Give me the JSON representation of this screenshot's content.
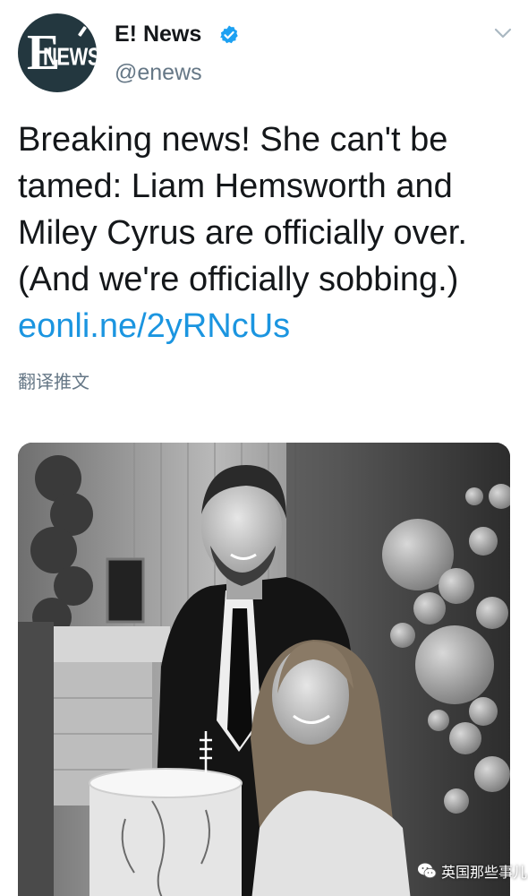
{
  "account": {
    "display_name": "E! News",
    "handle": "@enews",
    "verified": true,
    "avatar_letter": "E",
    "avatar_word": "NEWS"
  },
  "tweet": {
    "lines": [
      "Breaking news! She can't be",
      "tamed: Liam Hemsworth and",
      "Miley Cyrus are officially over.",
      "(And we're officially sobbing.)"
    ],
    "link": "eonli.ne/2yRNcUs",
    "translate_label": "翻译推文"
  },
  "watermark": {
    "label": "英国那些事儿"
  },
  "colors": {
    "text": "#14171a",
    "secondary": "#657786",
    "link": "#1b95e0",
    "verified": "#1da1f2",
    "avatar_bg": "#23373f"
  },
  "icons": [
    "verified-badge-icon",
    "chevron-down-icon",
    "wechat-icon"
  ]
}
